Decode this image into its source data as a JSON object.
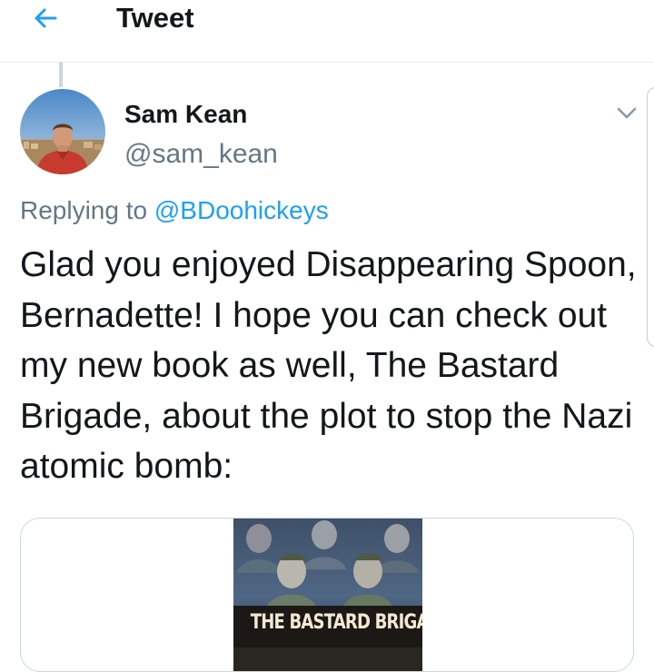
{
  "header": {
    "title": "Tweet",
    "back_icon": "arrow-left-icon"
  },
  "tweet": {
    "display_name": "Sam Kean",
    "handle": "@sam_kean",
    "replying_prefix": "Replying to",
    "replying_handle": "@BDoohickeys",
    "text": "Glad you enjoyed Disappearing Spoon, Bernadette! I hope you can check out my new book as well, The Bastard Brigade, about the plot to stop the Nazi atomic bomb:",
    "menu_icon": "chevron-down-icon"
  },
  "card": {
    "book_title": "THE BASTARD BRIGADE"
  },
  "colors": {
    "accent": "#1da1f2",
    "secondary_text": "#657786",
    "primary_text": "#14171a",
    "divider": "#e6ecf0"
  }
}
